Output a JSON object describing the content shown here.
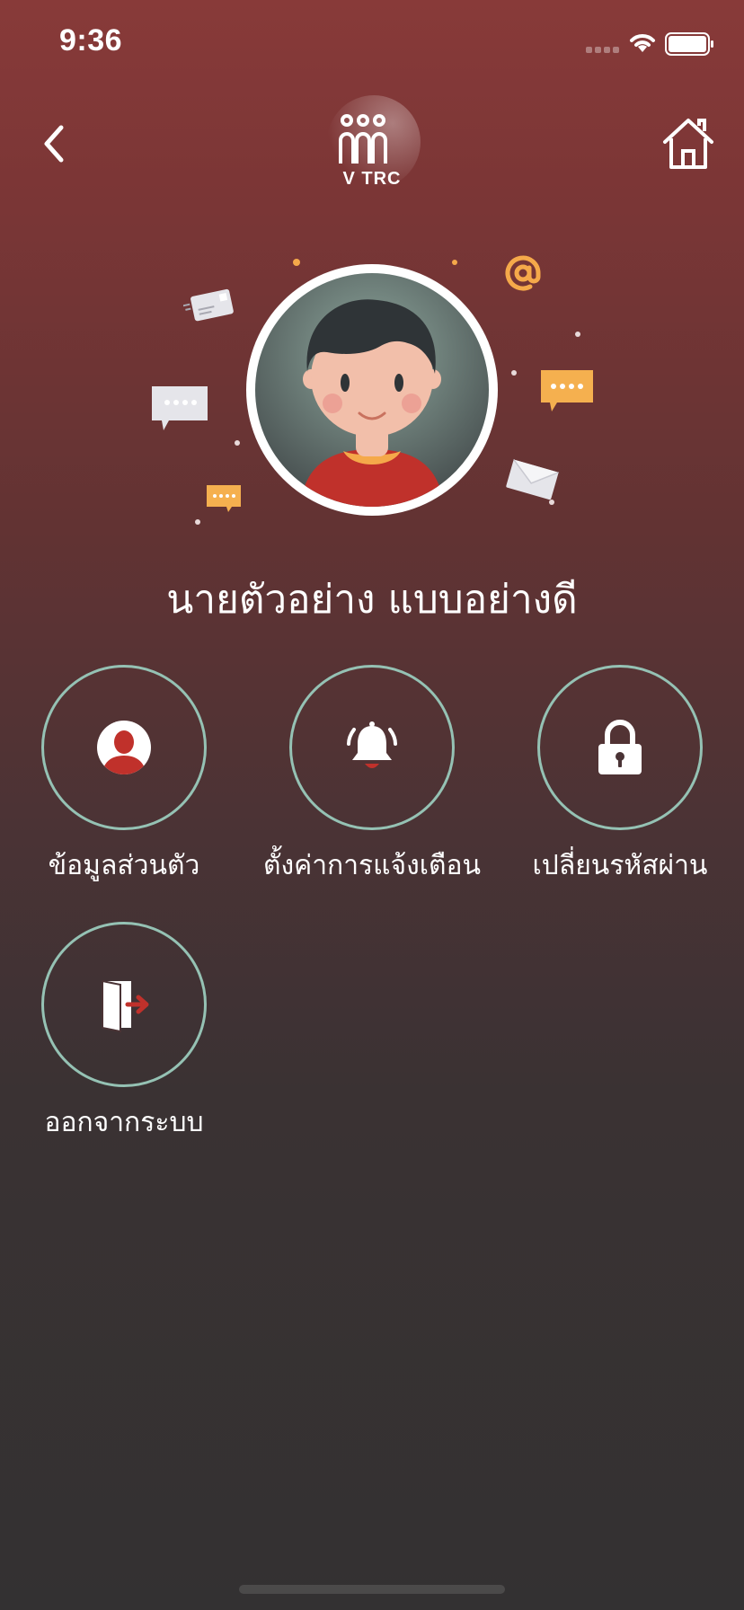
{
  "status_bar": {
    "time": "9:36"
  },
  "nav": {
    "back_icon": "chevron-left-icon",
    "home_icon": "home-icon"
  },
  "logo": {
    "text": "V TRC"
  },
  "profile": {
    "name": "นายตัวอย่าง แบบอย่างดี"
  },
  "menu": [
    {
      "label": "ข้อมูลส่วนตัว",
      "icon": "user-icon"
    },
    {
      "label": "ตั้งค่าการแจ้งเตือน",
      "icon": "bell-icon"
    },
    {
      "label": "เปลี่ยนรหัสผ่าน",
      "icon": "lock-icon"
    },
    {
      "label": "ออกจากระบบ",
      "icon": "logout-icon"
    }
  ],
  "colors": {
    "background_top": "#883a39",
    "background_bottom": "#333132",
    "menu_ring": "#95c2b4",
    "accent_red": "#c0312b",
    "accent_orange": "#f5a94a"
  }
}
